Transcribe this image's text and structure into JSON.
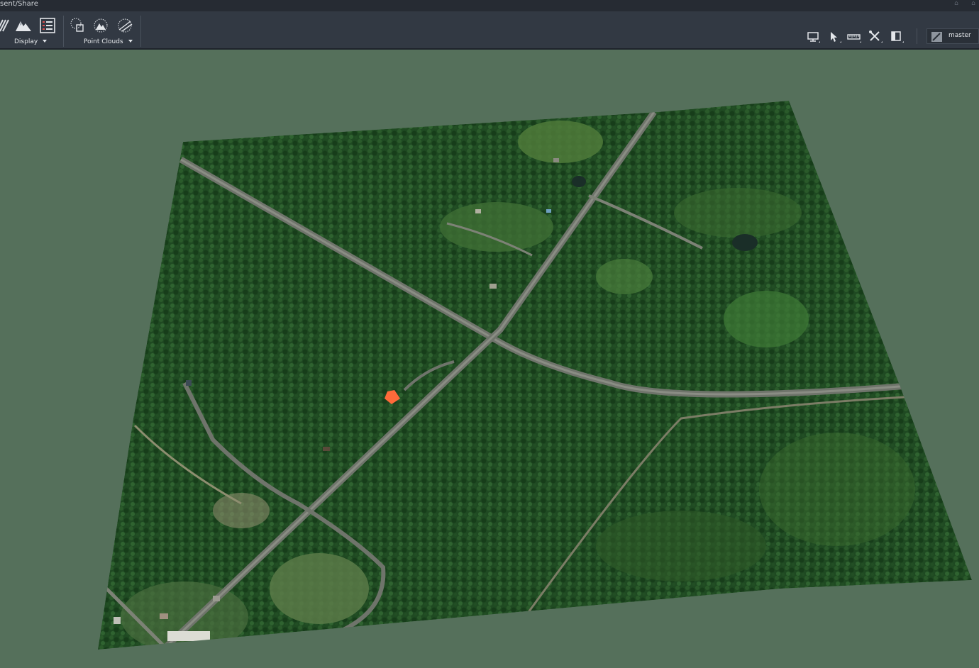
{
  "window": {
    "title_fragment": "sent/Share"
  },
  "toolbar": {
    "groups": [
      {
        "label": "Display",
        "icons": [
          "layers-icon",
          "terrain-icon",
          "list-icon"
        ]
      },
      {
        "label": "Point Clouds",
        "icons": [
          "point-cloud-frame-icon",
          "point-cloud-terrain-icon",
          "point-cloud-slice-icon"
        ]
      }
    ],
    "right_icons": [
      "monitor-icon",
      "select-cursor-icon",
      "measure-icon",
      "tools-icon",
      "panel-icon"
    ],
    "branch": {
      "icon": "branch-icon",
      "label": "master"
    }
  },
  "viewport": {
    "content": "3D aerial terrain tile",
    "background_color": "#55705b",
    "accent_marker_color": "#ff6a3a"
  }
}
